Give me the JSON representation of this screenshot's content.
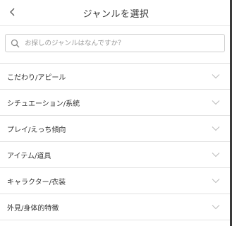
{
  "header": {
    "title": "ジャンルを選択",
    "back_icon": "chevron-left-icon"
  },
  "search": {
    "placeholder": "お探しのジャンルはなんですか？",
    "value": "",
    "icon": "search-icon"
  },
  "genres": [
    {
      "label": "こだわり/アピール"
    },
    {
      "label": "シチュエーション/系統"
    },
    {
      "label": "プレイ/えっち傾向"
    },
    {
      "label": "アイテム/道具"
    },
    {
      "label": "キャラクター/衣装"
    },
    {
      "label": "外見/身体的特徴"
    }
  ],
  "colors": {
    "text": "#333333",
    "placeholder": "#9a9a9a",
    "divider": "#e3e3e3",
    "chevron": "#bdbdbd"
  }
}
